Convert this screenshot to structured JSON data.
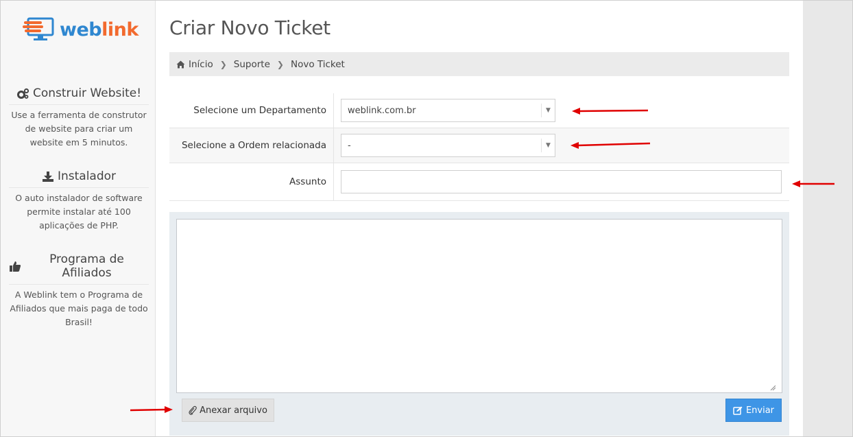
{
  "brand": {
    "logo_text_part1": "web",
    "logo_text_part2": "link"
  },
  "sidebar": {
    "promos": [
      {
        "icon": "gears-icon",
        "title": "Construir Website!",
        "text": "Use a ferramenta de construtor de website para criar um website em 5 minutos."
      },
      {
        "icon": "download-icon",
        "title": "Instalador",
        "text": "O auto instalador de software permite instalar até 100 aplicações de PHP."
      },
      {
        "icon": "thumbs-up-icon",
        "title": "Programa de Afiliados",
        "text": "A Weblink tem o Programa de Afiliados que mais paga de todo Brasil!"
      }
    ]
  },
  "page": {
    "title": "Criar Novo Ticket"
  },
  "breadcrumb": {
    "home_icon": "home-icon",
    "items": [
      "Início",
      "Suporte",
      "Novo Ticket"
    ]
  },
  "form": {
    "department": {
      "label": "Selecione um Departamento",
      "value": "weblink.com.br"
    },
    "order": {
      "label": "Selecione a Ordem relacionada",
      "value": "-"
    },
    "subject": {
      "label": "Assunto",
      "value": ""
    },
    "message": {
      "value": ""
    },
    "attach_button": {
      "icon": "paperclip-icon",
      "label": "Anexar arquivo"
    },
    "send_button": {
      "icon": "edit-icon",
      "label": "Enviar"
    }
  },
  "colors": {
    "primary": "#3e95e6",
    "brand_blue": "#2f87d0",
    "brand_orange": "#f26a2e",
    "annotation_red": "#e00000"
  }
}
